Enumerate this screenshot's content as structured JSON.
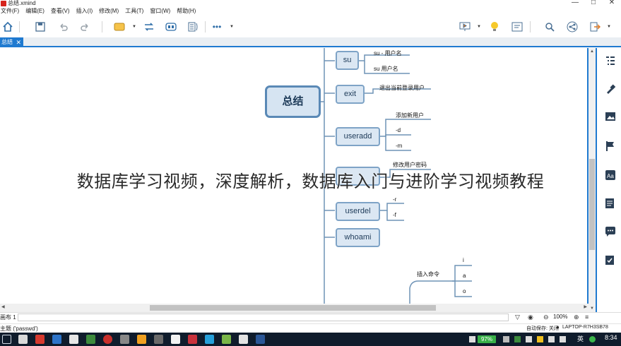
{
  "window": {
    "title": "总结.xmind",
    "controls": [
      "—",
      "□",
      "✕"
    ]
  },
  "menu": [
    "文件(F)",
    "编辑(E)",
    "查看(V)",
    "插入(I)",
    "修改(M)",
    "工具(T)",
    "窗口(W)",
    "帮助(H)"
  ],
  "tab": {
    "label": "总结",
    "close": "✕"
  },
  "mindmap": {
    "root": "总结",
    "topics": [
      {
        "label": "su",
        "subs": [
          "su - 用户名",
          "su 用户名"
        ]
      },
      {
        "label": "exit",
        "subs": [
          "退出当前登录用户"
        ]
      },
      {
        "label": "useradd",
        "subs": [
          "添加新用户",
          "-d",
          "-m"
        ]
      },
      {
        "label": "",
        "subs": [
          "修改用户密码"
        ]
      },
      {
        "label": "userdel",
        "subs": [
          "-r",
          "-f"
        ]
      },
      {
        "label": "whoami",
        "subs": []
      }
    ],
    "floating": {
      "label": "插入命令",
      "subs": [
        "i",
        "a",
        "o"
      ]
    }
  },
  "overlay_text": "数据库学习视频，深度解析，数据库入门与进阶学习视频教程",
  "status": {
    "sheet_label": "画布 1",
    "zoom": "100%",
    "selection": "主题 ('passwd')",
    "autosave": "自动保存: 关闭",
    "user": "LAPTOP-R7H3SB78"
  },
  "taskbar": {
    "battery": "97%",
    "lang": "英",
    "time": "8:34"
  },
  "colors": {
    "accent": "#1f7ad0",
    "topic_fill": "#dbe7f3",
    "topic_border": "#7ea3c6",
    "taskbar": "#0f1c2c"
  }
}
